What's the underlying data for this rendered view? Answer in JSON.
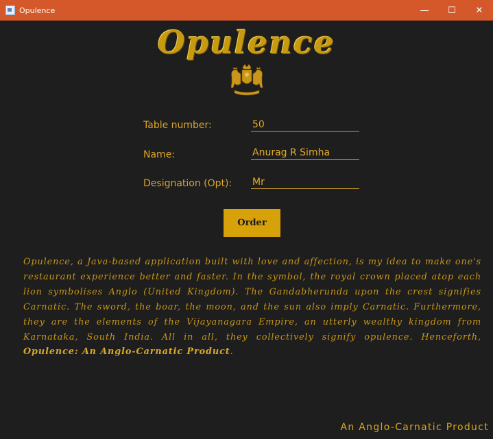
{
  "window": {
    "title": "Opulence",
    "minimize": "—",
    "maximize": "☐",
    "close": "✕"
  },
  "logo": {
    "title": "Opulence",
    "crest_icon": "royal-crest-icon"
  },
  "form": {
    "table_label": "Table number:",
    "table_value": "50",
    "name_label": "Name:",
    "name_value": "Anurag R Simha",
    "designation_label": "Designation (Opt):",
    "designation_value": "Mr"
  },
  "order_button": "Order",
  "description": {
    "text": "Opulence, a Java-based application built with love and affection, is my idea to make one's restaurant experience better and faster. In the symbol, the royal crown placed atop each lion symbolises Anglo (United Kingdom). The Gandabherunda upon the crest signifies Carnatic. The sword, the boar, the moon, and the sun also imply Carnatic. Furthermore, they are the elements of the Vijayanagara Empire, an utterly wealthy kingdom from Karnataka, South India. All in all, they collectively signify opulence. Henceforth, ",
    "bold_text": "Opulence: An Anglo-Carnatic Product",
    "end": "."
  },
  "footer": "An Anglo-Carnatic Product",
  "colors": {
    "titlebar": "#d4582a",
    "background": "#1e1e1e",
    "gold": "#d7a109"
  }
}
